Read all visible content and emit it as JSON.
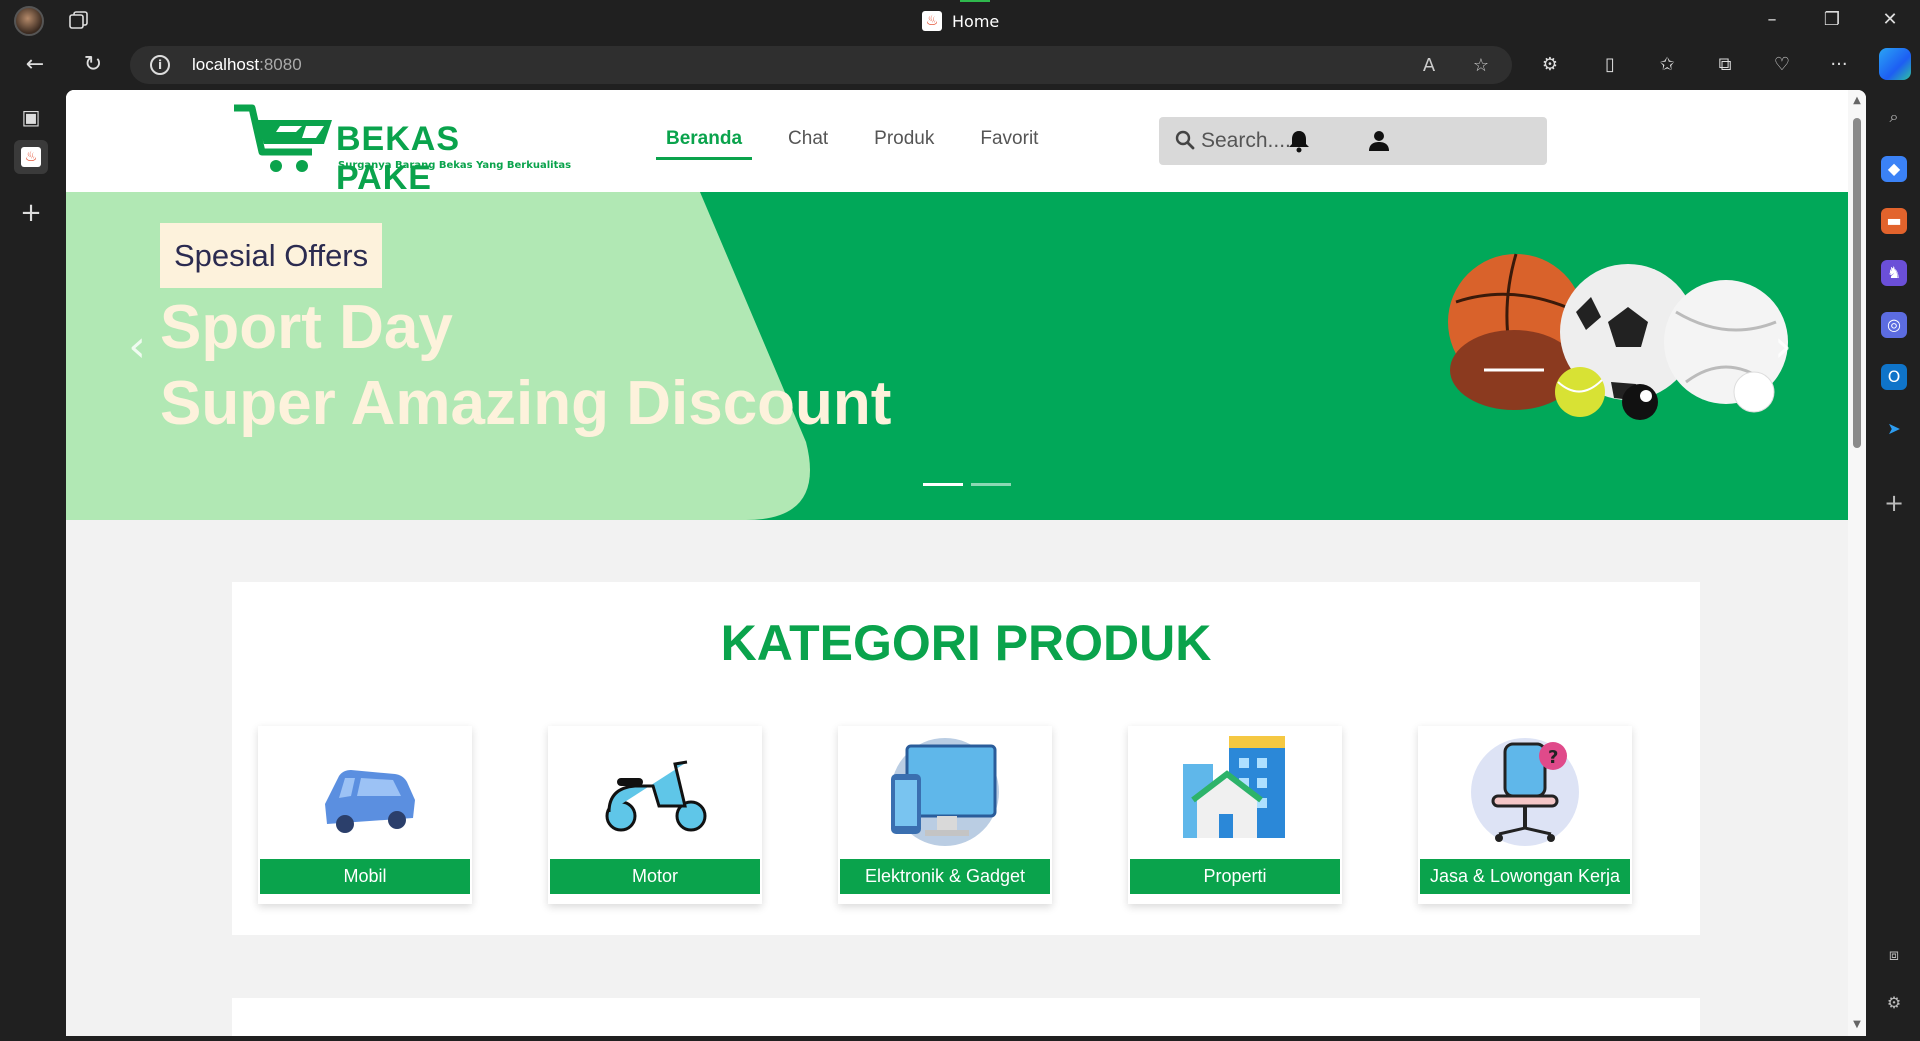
{
  "browser": {
    "tab_title": "Home",
    "url_host": "localhost",
    "url_port": ":8080"
  },
  "site": {
    "brand": "BEKAS PAKE",
    "tagline": "Surganya Barang Bekas Yang Berkualitas",
    "nav": [
      {
        "label": "Beranda",
        "active": true
      },
      {
        "label": "Chat",
        "active": false
      },
      {
        "label": "Produk",
        "active": false
      },
      {
        "label": "Favorit",
        "active": false
      }
    ],
    "search_placeholder": "Search....",
    "accent_color": "#0aa34c"
  },
  "banner": {
    "offer_badge": "Spesial Offers",
    "headline_1": "Sport Day",
    "headline_2": "Super Amazing Discount",
    "slide_count": 2,
    "active_slide": 1
  },
  "categories": {
    "title": "KATEGORI PRODUK",
    "items": [
      {
        "label": "Mobil",
        "icon": "car-icon"
      },
      {
        "label": "Motor",
        "icon": "scooter-icon"
      },
      {
        "label": "Elektronik & Gadget",
        "icon": "monitor-phone-icon"
      },
      {
        "label": "Properti",
        "icon": "building-icon"
      },
      {
        "label": "Jasa & Lowongan Kerja",
        "icon": "office-chair-icon"
      }
    ]
  }
}
